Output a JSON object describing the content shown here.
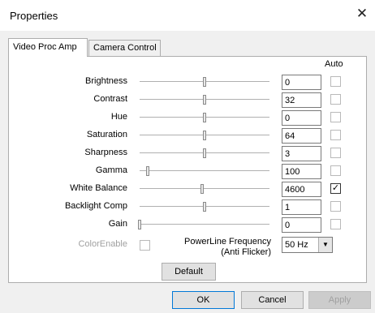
{
  "window": {
    "title": "Properties"
  },
  "tabs": [
    {
      "label": "Video Proc Amp",
      "active": true
    },
    {
      "label": "Camera Control",
      "active": false
    }
  ],
  "auto_header": "Auto",
  "properties": [
    {
      "label": "Brightness",
      "value": "0",
      "slider_fraction": 0.5,
      "auto": false
    },
    {
      "label": "Contrast",
      "value": "32",
      "slider_fraction": 0.5,
      "auto": false
    },
    {
      "label": "Hue",
      "value": "0",
      "slider_fraction": 0.5,
      "auto": false
    },
    {
      "label": "Saturation",
      "value": "64",
      "slider_fraction": 0.5,
      "auto": false
    },
    {
      "label": "Sharpness",
      "value": "3",
      "slider_fraction": 0.5,
      "auto": false
    },
    {
      "label": "Gamma",
      "value": "100",
      "slider_fraction": 0.06,
      "auto": false
    },
    {
      "label": "White Balance",
      "value": "4600",
      "slider_fraction": 0.48,
      "auto": true
    },
    {
      "label": "Backlight Comp",
      "value": "1",
      "slider_fraction": 0.5,
      "auto": false
    },
    {
      "label": "Gain",
      "value": "0",
      "slider_fraction": 0.0,
      "auto": false
    }
  ],
  "color_enable": {
    "label": "ColorEnable",
    "checked": false
  },
  "powerline": {
    "label_line1": "PowerLine Frequency",
    "label_line2": "(Anti Flicker)",
    "selected": "50 Hz"
  },
  "buttons": {
    "default": "Default",
    "ok": "OK",
    "cancel": "Cancel",
    "apply": "Apply"
  }
}
